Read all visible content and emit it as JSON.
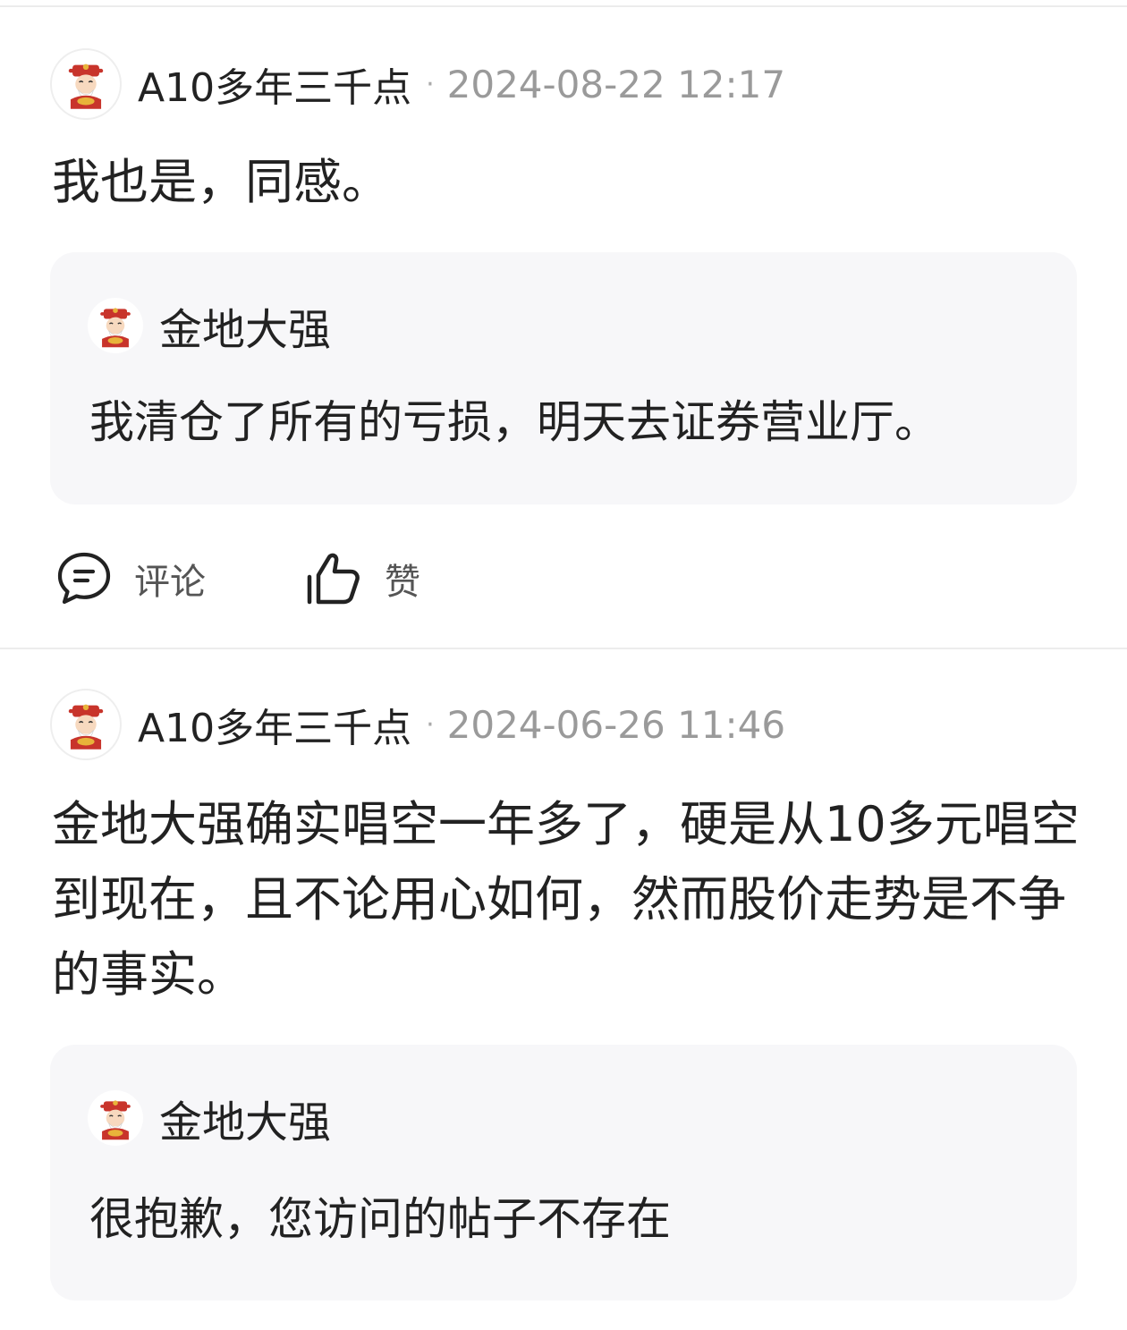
{
  "posts": [
    {
      "author": "A10多年三千点",
      "separator": "·",
      "time": "2024-08-22 12:17",
      "content": "我也是，同感。",
      "quote": {
        "author": "金地大强",
        "text": "我清仓了所有的亏损，明天去证券营业厅。"
      },
      "actions": {
        "comment": "评论",
        "like": "赞"
      }
    },
    {
      "author": "A10多年三千点",
      "separator": "·",
      "time": "2024-06-26 11:46",
      "content": "金地大强确实唱空一年多了，硬是从10多元唱空到现在，且不论用心如何，然而股价走势是不争的事实。",
      "quote": {
        "author": "金地大强",
        "text": "很抱歉，您访问的帖子不存在"
      }
    }
  ],
  "icons": {
    "avatar": "caishen-avatar-icon",
    "comment": "comment-bubble-icon",
    "like": "thumbs-up-icon"
  },
  "colors": {
    "text": "#222222",
    "meta": "#9a9a9a",
    "quote_bg": "#f7f7f9",
    "divider": "#ececec"
  }
}
